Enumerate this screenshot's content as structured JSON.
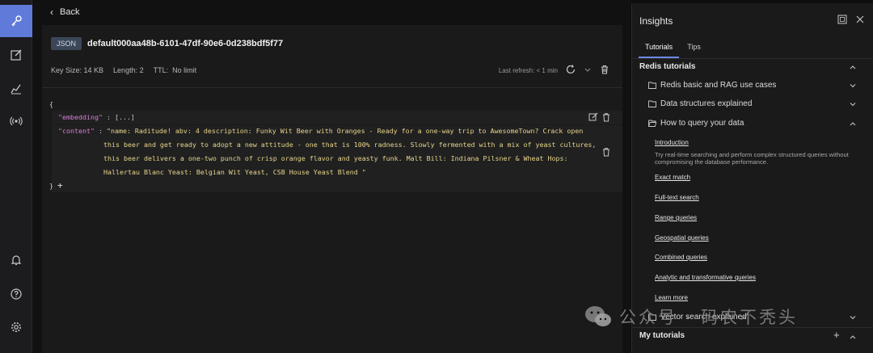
{
  "nav": {
    "items": [
      "key-icon",
      "edit-icon",
      "analytics-icon",
      "pubsub-icon"
    ],
    "bottom": [
      "bell-icon",
      "help-icon",
      "settings-icon"
    ]
  },
  "topbar": {
    "back_label": "Back"
  },
  "key": {
    "type": "JSON",
    "name": "default000aa48b-6101-47df-90e6-0d238bdf5f77",
    "size": "Key Size: 14 KB",
    "length": "Length: 2",
    "ttl_label": "TTL:",
    "ttl_value": "No limit",
    "refresh": "Last refresh: < 1 min"
  },
  "json": {
    "open": "{",
    "close": "}",
    "plus": "+",
    "embedding_key": "\"embedding\"",
    "embedding_value": "[...]",
    "content_key": "\"content\"",
    "content_lines": [
      "\"name: Raditude! abv: 4 description: Funky Wit Beer with Oranges - Ready for a one-way trip to AwesomeTown? Crack open",
      "this beer and get ready to adopt a new attitude - one that is 100% radness. Slowly fermented with a mix of yeast cultures,",
      "this beer delivers a one-two punch of crisp orange flavor and yeasty funk. Malt Bill: Indiana Pilsner & Wheat Hops:",
      "Hallertau Blanc Yeast: Belgian Wit Yeast, CSB House Yeast Blend \""
    ]
  },
  "insights": {
    "title": "Insights",
    "tabs": [
      "Tutorials",
      "Tips"
    ],
    "section": "Redis tutorials",
    "folders": [
      "Redis basic and RAG use cases",
      "Data structures explained",
      "How to query your data"
    ],
    "intro": "Introduction",
    "intro_desc": "Try real-time searching and perform complex structured queries without compromising the database performance.",
    "links": [
      "Exact match",
      "Full-text search",
      "Range queries",
      "Geospatial queries",
      "Combined queries",
      "Analytic and transformative queries",
      "Learn more"
    ],
    "folder_last": "Vector search explained",
    "my_tutorials": "My tutorials"
  },
  "watermark": {
    "text": "公众号 · 码农不秃头"
  }
}
